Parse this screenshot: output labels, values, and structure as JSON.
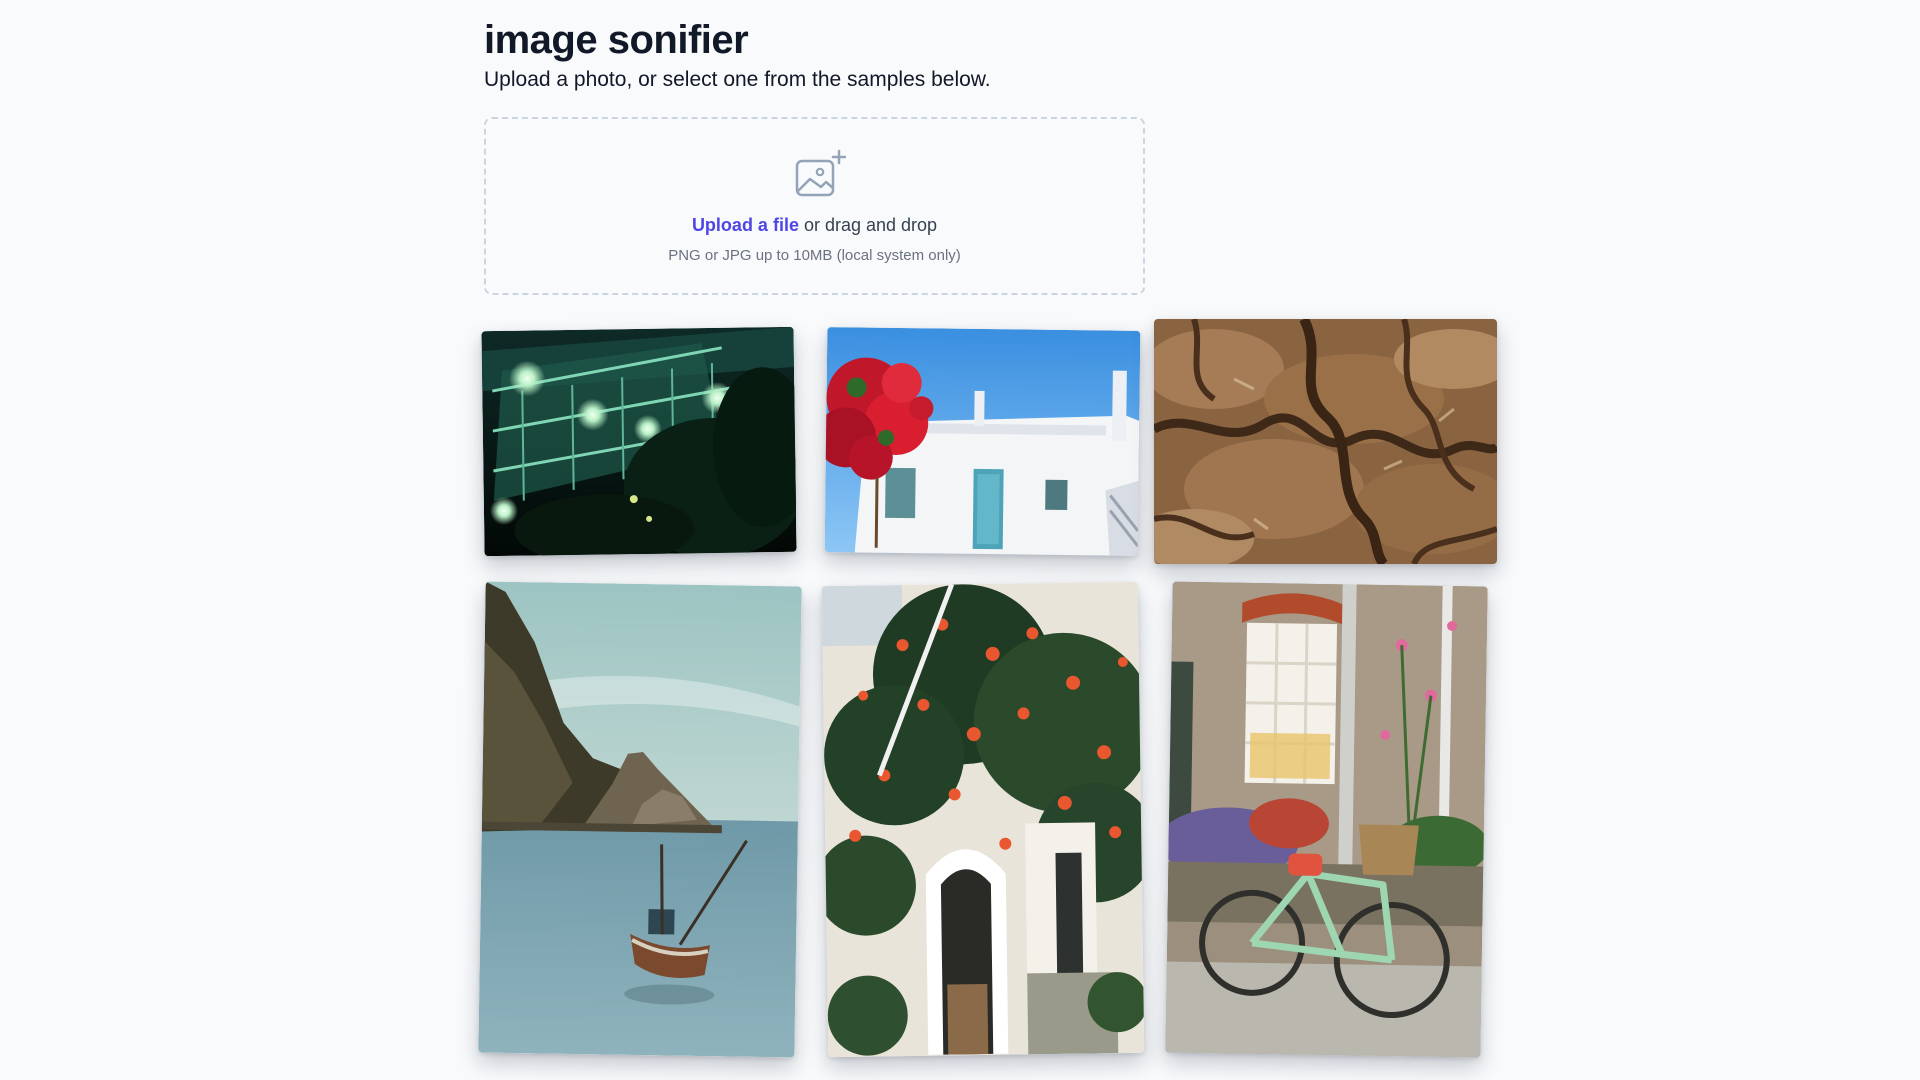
{
  "header": {
    "title": "image sonifier",
    "subtitle": "Upload a photo, or select one from the samples below."
  },
  "upload": {
    "icon": "image-plus-icon",
    "link_label": "Upload a file",
    "drag_label": " or drag and drop",
    "hint": "PNG or JPG up to 10MB (local system only)"
  },
  "samples": [
    {
      "icon": "photo-night-walkway"
    },
    {
      "icon": "photo-white-house-red-flowers"
    },
    {
      "icon": "photo-brown-texture"
    },
    {
      "icon": "photo-boat-rocky-coast"
    },
    {
      "icon": "photo-flowering-vine-doorway"
    },
    {
      "icon": "photo-bicycle-brick-house"
    }
  ],
  "colors": {
    "background": "#f8fafc",
    "accent": "#4f46e5",
    "dropzone_border": "#cbd5e1"
  }
}
